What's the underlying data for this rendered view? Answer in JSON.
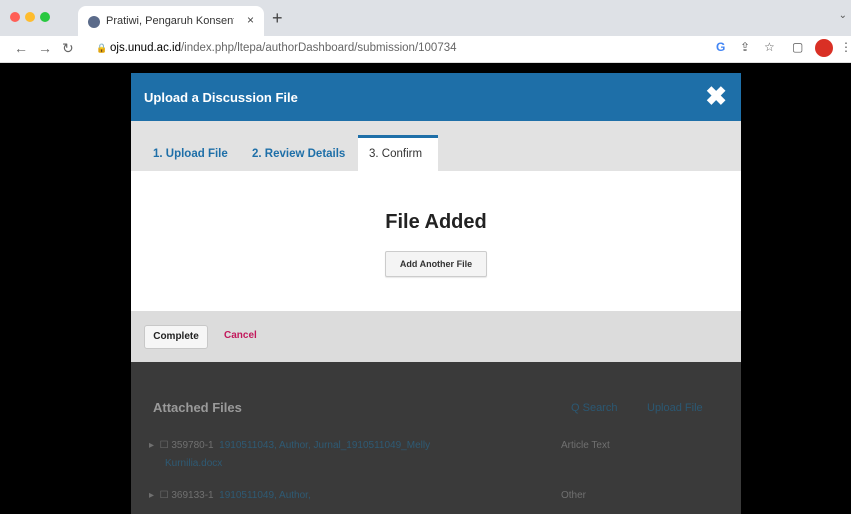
{
  "browser": {
    "tab_title": "Pratiwi, Pengaruh Konsentrasi",
    "tab_close": "×",
    "new_tab": "+",
    "url_host": "ojs.unud.ac.id",
    "url_path": "/index.php/ltepa/authorDashboard/submission/100734"
  },
  "modal": {
    "title": "Upload a Discussion File",
    "close": "✖",
    "tabs": [
      "1. Upload File",
      "2. Review Details",
      "3. Confirm"
    ],
    "heading": "File Added",
    "add_another": "Add Another File",
    "complete": "Complete",
    "cancel": "Cancel"
  },
  "behind": {
    "title": "Attached Files",
    "search": "Q Search",
    "upload": "Upload File",
    "rows": [
      {
        "id": "359780-1",
        "name": "1910511043, Author, Jurnal_1910511049_Melly",
        "name2": "Kurnilia.docx",
        "type": "Article Text"
      },
      {
        "id": "369133-1",
        "name": "1910511049, Author,",
        "name2": "",
        "type": "Other"
      }
    ]
  },
  "colors": {
    "header": "#1e6fa8",
    "cancel": "#c2185b"
  }
}
